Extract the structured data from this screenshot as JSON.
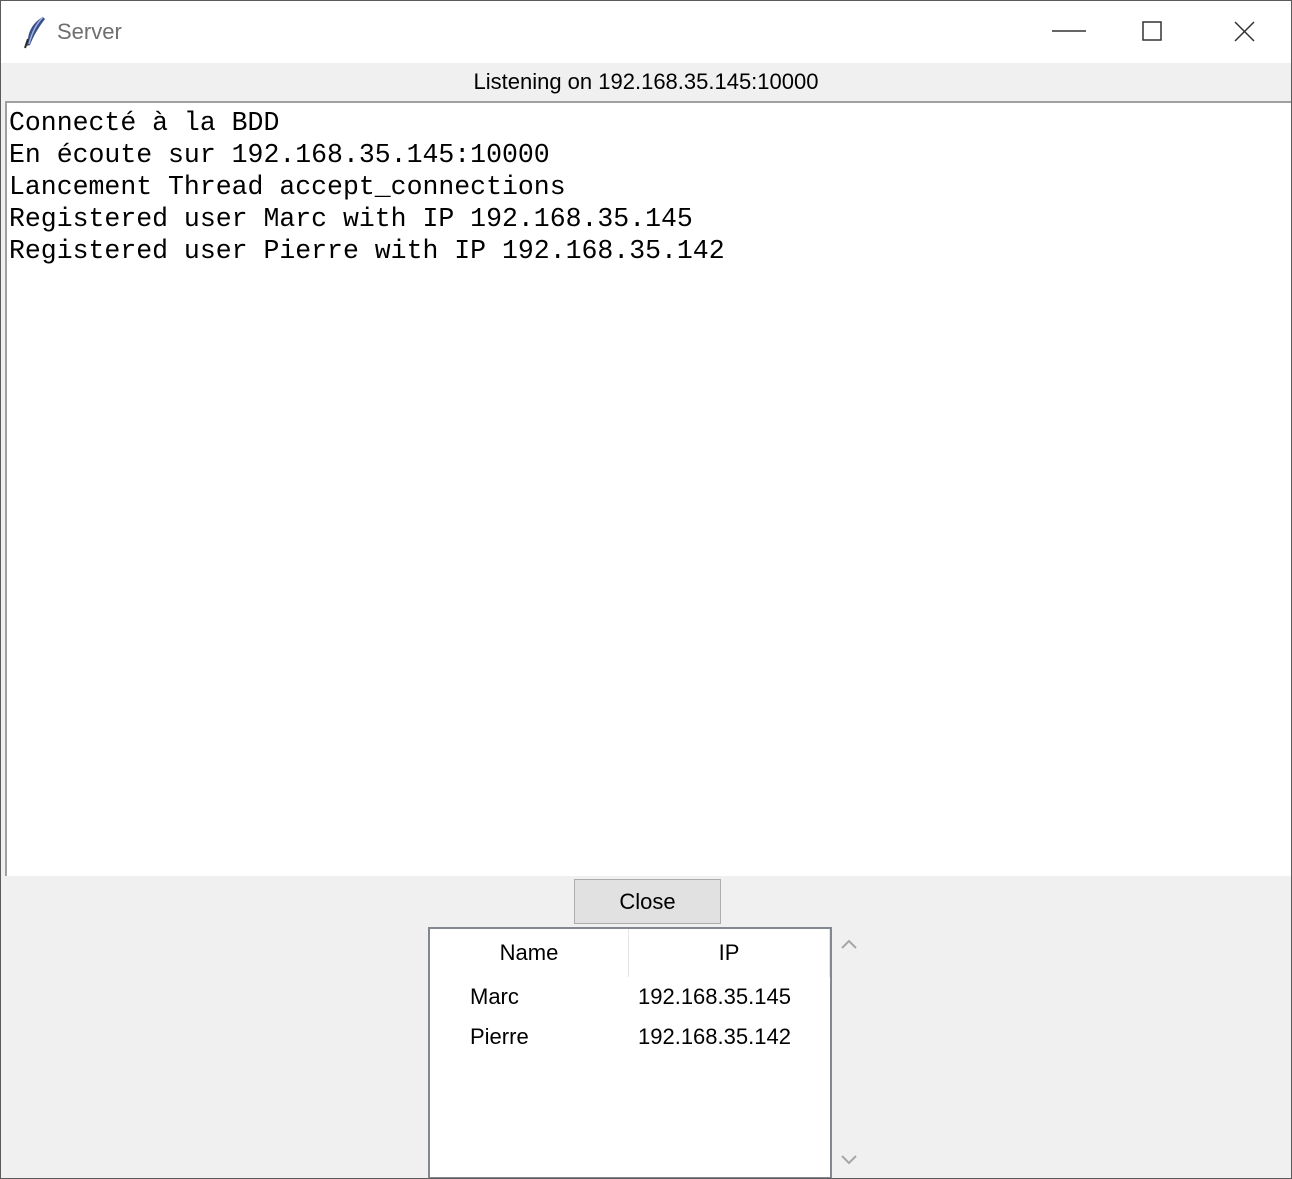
{
  "window": {
    "title": "Server",
    "app_icon": "feather-icon",
    "controls": [
      "minimize-icon",
      "maximize-icon",
      "close-icon"
    ]
  },
  "status": {
    "text": "Listening on 192.168.35.145:10000"
  },
  "log": {
    "lines": [
      "Connecté à la BDD",
      "En écoute sur 192.168.35.145:10000",
      "Lancement Thread accept_connections",
      "Registered user Marc with IP 192.168.35.145",
      "Registered user Pierre with IP 192.168.35.142"
    ]
  },
  "actions": {
    "close_label": "Close"
  },
  "users_table": {
    "columns": [
      "Name",
      "IP"
    ],
    "rows": [
      {
        "name": "Marc",
        "ip": "192.168.35.145"
      },
      {
        "name": "Pierre",
        "ip": "192.168.35.142"
      }
    ]
  },
  "scrollbar": {
    "icons": [
      "chevron-up-icon",
      "chevron-down-icon"
    ]
  }
}
